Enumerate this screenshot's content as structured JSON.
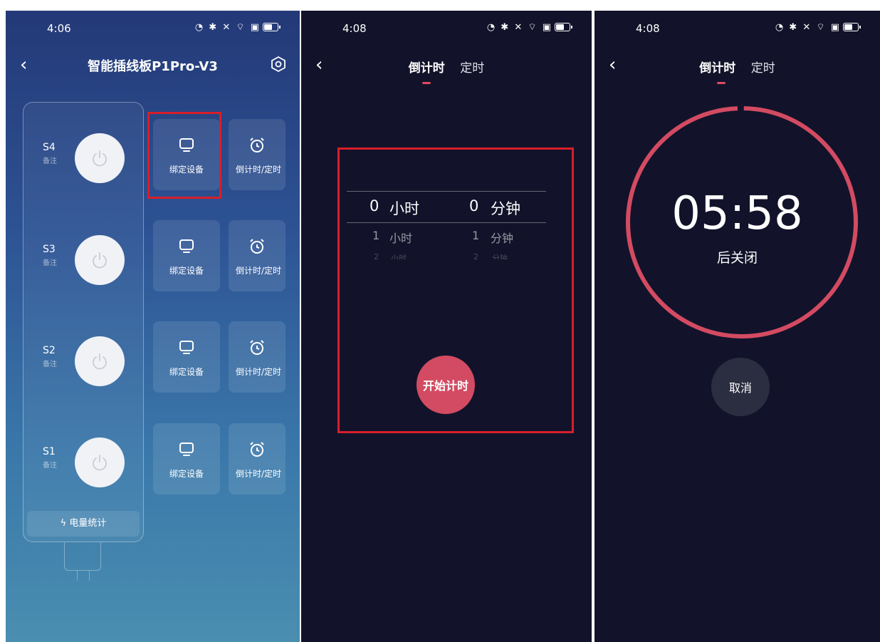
{
  "screen1": {
    "status_time": "4:06",
    "title": "智能插线板P1Pro-V3",
    "sockets": [
      {
        "label": "S4",
        "note": "备注"
      },
      {
        "label": "S3",
        "note": "备注"
      },
      {
        "label": "S2",
        "note": "备注"
      },
      {
        "label": "S1",
        "note": "备注"
      }
    ],
    "bind_label": "绑定设备",
    "timer_label": "倒计时/定时",
    "energy_label": "电量统计"
  },
  "screen2": {
    "status_time": "4:08",
    "tab_countdown": "倒计时",
    "tab_schedule": "定时",
    "picker_rows": [
      {
        "hours": "0",
        "hour_unit": "小时",
        "minutes": "0",
        "minute_unit": "分钟"
      },
      {
        "hours": "1",
        "hour_unit": "小时",
        "minutes": "1",
        "minute_unit": "分钟"
      },
      {
        "hours": "2",
        "hour_unit": "小时",
        "minutes": "2",
        "minute_unit": "分钟"
      }
    ],
    "start_label": "开始计时"
  },
  "screen3": {
    "status_time": "4:08",
    "tab_countdown": "倒计时",
    "tab_schedule": "定时",
    "remaining": "05:58",
    "after_label": "后关闭",
    "cancel_label": "取消"
  },
  "colors": {
    "accent": "#d34b62",
    "dark_bg": "#12132a",
    "highlight": "#d81e2a"
  }
}
